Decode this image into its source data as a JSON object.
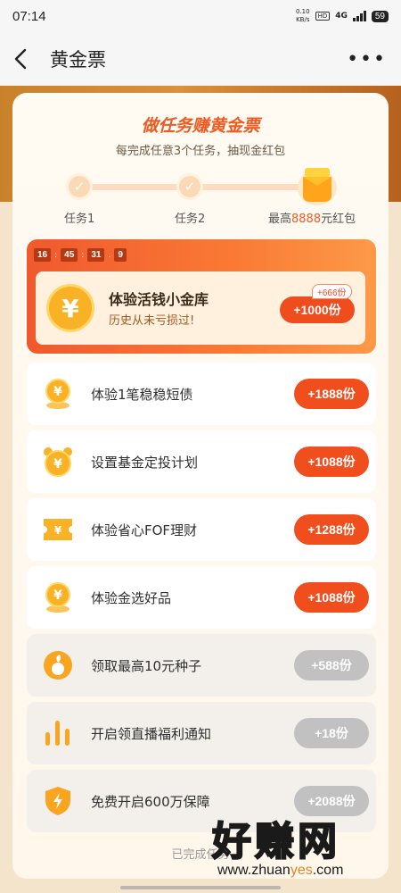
{
  "status_bar": {
    "time": "07:14",
    "net_speed_value": "0.10",
    "net_speed_unit": "KB/s",
    "hd_label": "HD",
    "network_type": "4G",
    "battery": "59"
  },
  "nav": {
    "title": "黄金票",
    "more_label": "•••"
  },
  "header": {
    "title": "做任务赚黄金票",
    "subtitle": "每完成任意3个任务，抽现金红包"
  },
  "progress": {
    "step1_label": "任务1",
    "step2_label": "任务2",
    "reward_prefix": "最高",
    "reward_amount": "8888",
    "reward_suffix": "元红包"
  },
  "featured": {
    "timer": [
      "16",
      "45",
      "31",
      "9"
    ],
    "name": "体验活钱小金库",
    "desc": "历史从未亏损过!",
    "button": "+1000份",
    "bonus": "+666份"
  },
  "tasks": [
    {
      "name": "体验1笔稳稳短债",
      "button": "+1888份",
      "icon": "coin-stand-icon",
      "state": "active"
    },
    {
      "name": "设置基金定投计划",
      "button": "+1088份",
      "icon": "alarm-coin-icon",
      "state": "active"
    },
    {
      "name": "体验省心FOF理财",
      "button": "+1288份",
      "icon": "ticket-icon",
      "state": "active"
    },
    {
      "name": "体验金选好品",
      "button": "+1088份",
      "icon": "coin-stand-icon",
      "state": "active"
    },
    {
      "name": "领取最高10元种子",
      "button": "+588份",
      "icon": "seed-icon",
      "state": "done"
    },
    {
      "name": "开启领直播福利通知",
      "button": "+18份",
      "icon": "bar-chart-icon",
      "state": "done"
    },
    {
      "name": "免费开启600万保障",
      "button": "+2088份",
      "icon": "shield-bolt-icon",
      "state": "done"
    }
  ],
  "footer_note": "已完成任务",
  "watermark": {
    "text": "好赚网",
    "url_prefix": "www.zhuan",
    "url_highlight": "yes",
    "url_suffix": ".com"
  },
  "colors": {
    "accent": "#ef5a21",
    "button_active": "#f04e1c",
    "button_done": "#c1c1c1",
    "coin": "#f9b226"
  }
}
